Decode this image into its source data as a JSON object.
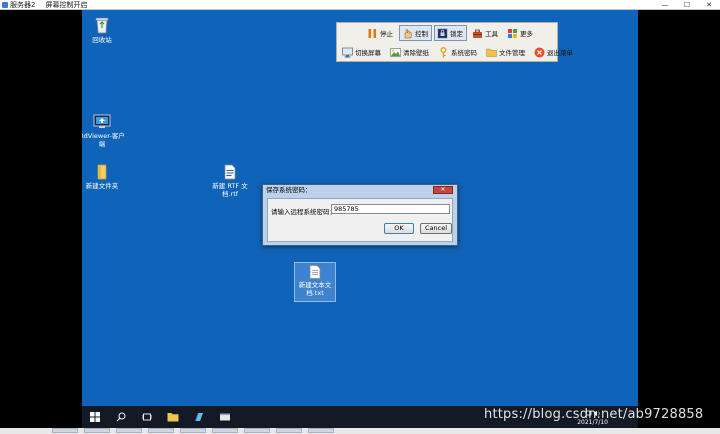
{
  "window": {
    "title_parts": [
      "服务器2",
      "屏幕控制开启"
    ],
    "controls": [
      "—",
      "☐",
      "✕"
    ]
  },
  "desktop_icons": [
    {
      "name": "recycle-bin",
      "label": "回收站"
    },
    {
      "name": "rdviewer",
      "label": "RdViewer-客户端"
    },
    {
      "name": "new-folder",
      "label": "新建文件夹"
    },
    {
      "name": "rtf-doc",
      "label": "新建 RTF 文档.rtf"
    },
    {
      "name": "txt-doc",
      "label": "新建文本文档.txt"
    }
  ],
  "toolbar": {
    "row1": [
      {
        "label": "停止",
        "icon": "pause-icon",
        "active": false
      },
      {
        "label": "控制",
        "icon": "hand-icon",
        "active": true
      },
      {
        "label": "锁定",
        "icon": "lock-screen-icon",
        "active": true
      },
      {
        "label": "工具",
        "icon": "toolbox-icon",
        "active": false
      },
      {
        "label": "更多",
        "icon": "apps-icon",
        "active": false
      }
    ],
    "row2": [
      {
        "label": "切换屏幕",
        "icon": "monitor-icon"
      },
      {
        "label": "清除壁纸",
        "icon": "wallpaper-icon"
      },
      {
        "label": "系统密码",
        "icon": "key-icon"
      },
      {
        "label": "文件管理",
        "icon": "folder-icon"
      },
      {
        "label": "退出菜单",
        "icon": "exit-icon"
      }
    ]
  },
  "dialog": {
    "title": "保存系统密码：",
    "label": "请输入远程系统密码：",
    "password_value": "985785",
    "ok_label": "OK",
    "cancel_label": "Cancel"
  },
  "taskbar": {
    "date": "2021/7/10"
  },
  "watermark": "https://blog.csdn.net/ab9728858",
  "colors": {
    "desktop_bg": "#0f63b8",
    "taskbar_bg": "#121a26",
    "dialog_frame": "#bcd2ea"
  }
}
